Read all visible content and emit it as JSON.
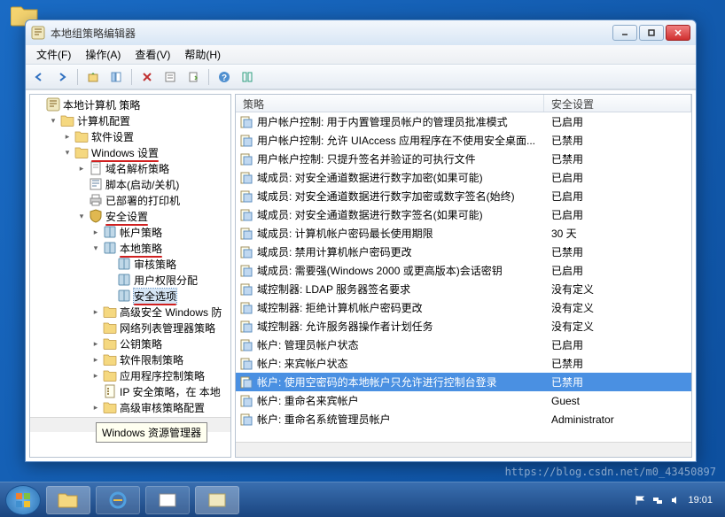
{
  "window": {
    "title": "本地组策略编辑器",
    "menus": [
      "文件(F)",
      "操作(A)",
      "查看(V)",
      "帮助(H)"
    ]
  },
  "tree": {
    "root": "本地计算机 策略",
    "n1": "计算机配置",
    "n1_1": "软件设置",
    "n1_2": "Windows 设置",
    "n1_2_1": "域名解析策略",
    "n1_2_2": "脚本(启动/关机)",
    "n1_2_3": "已部署的打印机",
    "n1_2_4": "安全设置",
    "n1_2_4_1": "帐户策略",
    "n1_2_4_2": "本地策略",
    "n1_2_4_2_1": "审核策略",
    "n1_2_4_2_2": "用户权限分配",
    "n1_2_4_2_3": "安全选项",
    "n1_2_4_3": "高级安全 Windows 防",
    "n1_2_4_4": "网络列表管理器策略",
    "n1_2_4_5": "公钥策略",
    "n1_2_4_6": "软件限制策略",
    "n1_2_4_7": "应用程序控制策略",
    "n1_2_4_8": "IP 安全策略，在 本地",
    "n1_2_4_9": "高级审核策略配置"
  },
  "columns": {
    "c0": "策略",
    "c1": "安全设置"
  },
  "rows": [
    {
      "name": "用户帐户控制: 用于内置管理员帐户的管理员批准模式",
      "value": "已启用"
    },
    {
      "name": "用户帐户控制: 允许 UIAccess 应用程序在不使用安全桌面...",
      "value": "已禁用"
    },
    {
      "name": "用户帐户控制: 只提升签名并验证的可执行文件",
      "value": "已禁用"
    },
    {
      "name": "域成员: 对安全通道数据进行数字加密(如果可能)",
      "value": "已启用"
    },
    {
      "name": "域成员: 对安全通道数据进行数字加密或数字签名(始终)",
      "value": "已启用"
    },
    {
      "name": "域成员: 对安全通道数据进行数字签名(如果可能)",
      "value": "已启用"
    },
    {
      "name": "域成员: 计算机帐户密码最长使用期限",
      "value": "30 天"
    },
    {
      "name": "域成员: 禁用计算机帐户密码更改",
      "value": "已禁用"
    },
    {
      "name": "域成员: 需要强(Windows 2000 或更高版本)会话密钥",
      "value": "已启用"
    },
    {
      "name": "域控制器: LDAP 服务器签名要求",
      "value": "没有定义"
    },
    {
      "name": "域控制器: 拒绝计算机帐户密码更改",
      "value": "没有定义"
    },
    {
      "name": "域控制器: 允许服务器操作者计划任务",
      "value": "没有定义"
    },
    {
      "name": "帐户: 管理员帐户状态",
      "value": "已启用"
    },
    {
      "name": "帐户: 来宾帐户状态",
      "value": "已禁用"
    },
    {
      "name": "帐户: 使用空密码的本地帐户只允许进行控制台登录",
      "value": "已禁用",
      "selected": true
    },
    {
      "name": "帐户: 重命名来宾帐户",
      "value": "Guest"
    },
    {
      "name": "帐户: 重命名系统管理员帐户",
      "value": "Administrator"
    }
  ],
  "taskbar": {
    "tooltip": "Windows 资源管理器",
    "time": "19:01"
  },
  "watermark": "https://blog.csdn.net/m0_43450897"
}
